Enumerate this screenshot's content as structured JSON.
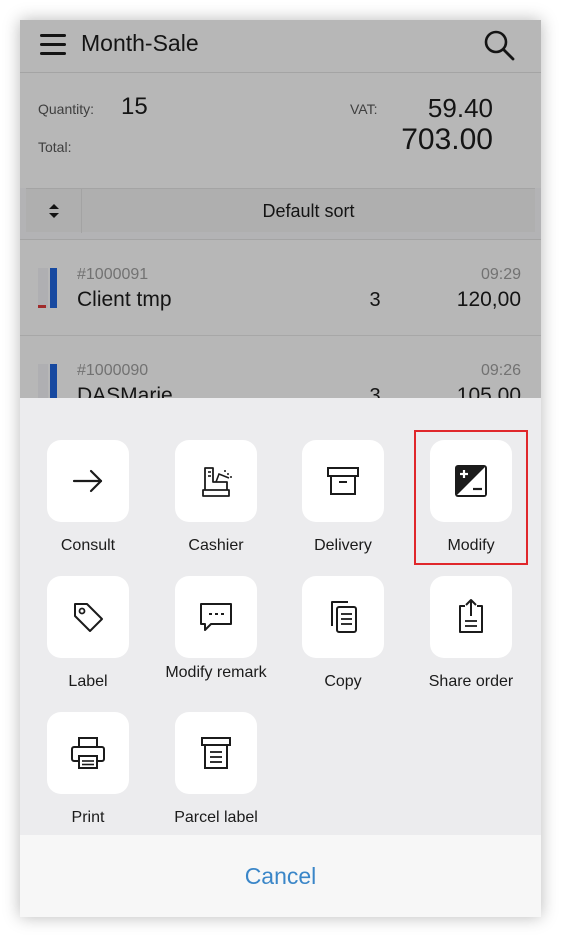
{
  "header": {
    "title": "Month-Sale",
    "menu_icon": "hamburger-menu-icon",
    "search_icon": "search-icon"
  },
  "summary": {
    "quantity_label": "Quantity:",
    "quantity_value": "15",
    "vat_label": "VAT:",
    "vat_value": "59.40",
    "total_label": "Total:",
    "total_value": "703.00"
  },
  "sort": {
    "icon": "sort-arrows-icon",
    "label": "Default sort"
  },
  "orders": [
    {
      "number": "#1000091",
      "client": "Client tmp",
      "quantity": "3",
      "time": "09:29",
      "amount": "120,00"
    },
    {
      "number": "#1000090",
      "client": "DASMarie",
      "quantity": "3",
      "time": "09:26",
      "amount": "105,00"
    }
  ],
  "actions": [
    {
      "label": "Consult",
      "icon": "arrow-right-icon"
    },
    {
      "label": "Cashier",
      "icon": "cash-register-icon"
    },
    {
      "label": "Delivery",
      "icon": "archive-box-icon"
    },
    {
      "label": "Modify",
      "icon": "plus-minus-icon"
    },
    {
      "label": "Label",
      "icon": "tag-icon"
    },
    {
      "label": "Modify remark",
      "icon": "comment-icon"
    },
    {
      "label": "Copy",
      "icon": "copy-icon"
    },
    {
      "label": "Share order",
      "icon": "share-icon"
    },
    {
      "label": "Print",
      "icon": "printer-icon"
    },
    {
      "label": "Parcel label",
      "icon": "parcel-label-icon"
    }
  ],
  "cancel_label": "Cancel",
  "colors": {
    "accent": "#3a86c8",
    "highlight": "#e0272b",
    "stripe": "#1f63d8"
  }
}
